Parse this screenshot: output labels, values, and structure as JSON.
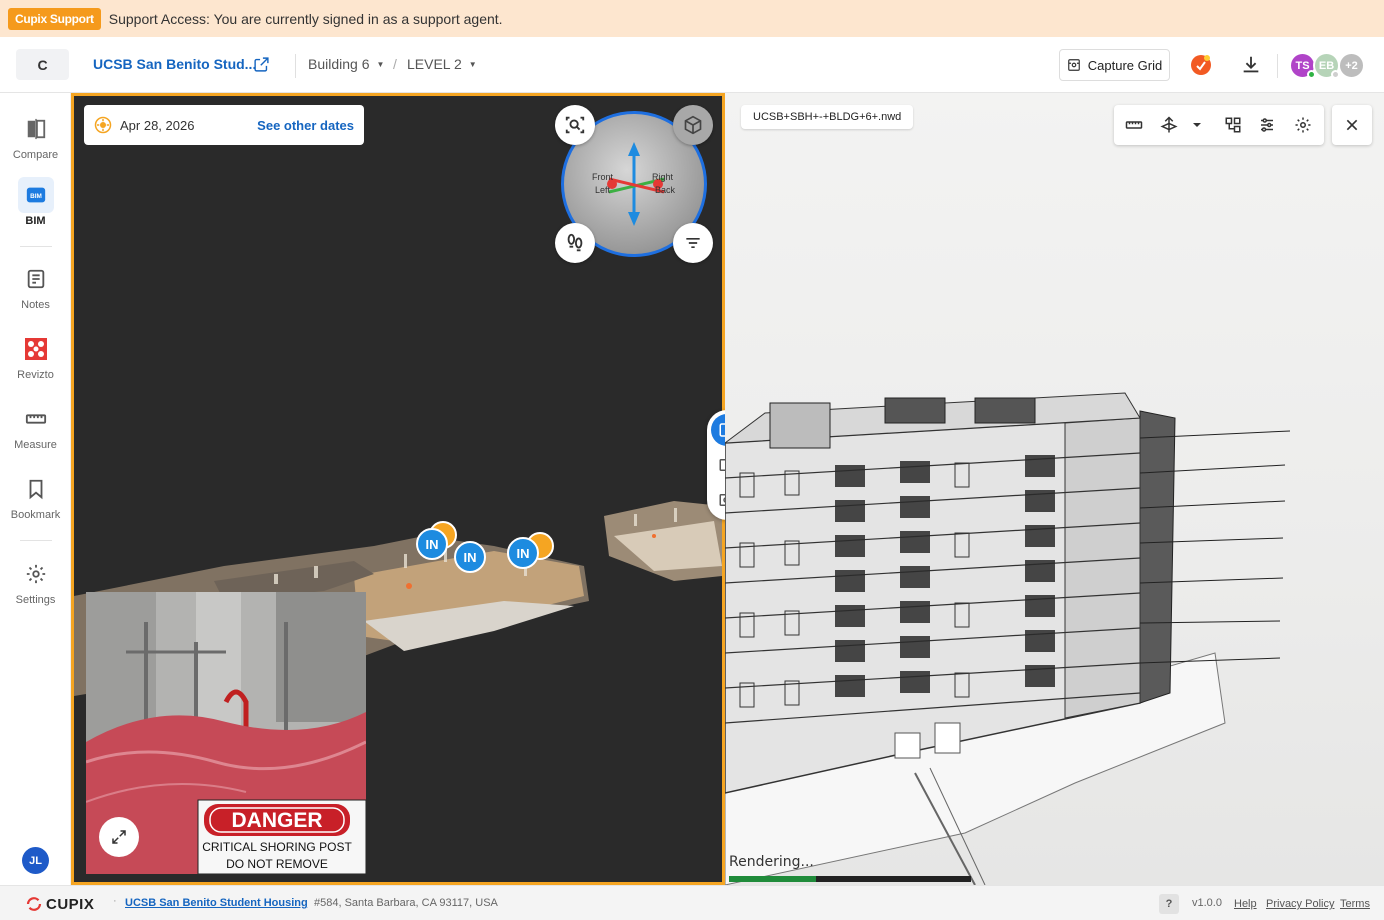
{
  "banner": {
    "badge": "Cupix Support",
    "text": "Support Access: You are currently signed in as a support agent."
  },
  "header": {
    "logo_letter": "C",
    "project_name": "UCSB San Benito Stud...",
    "breadcrumb": [
      {
        "label": "Building 6"
      },
      {
        "label": "LEVEL 2"
      }
    ],
    "breadcrumb_sep": "/",
    "capture_grid_label": "Capture Grid",
    "avatars": [
      {
        "initials": "TS",
        "color": "#b044c8",
        "status": "#2fb344"
      },
      {
        "initials": "EB",
        "color": "#b6d4b8",
        "status": "#cfcfcf"
      },
      {
        "initials": "+2",
        "color": "#bdbdbd"
      }
    ]
  },
  "sidebar": {
    "items": [
      {
        "label": "Compare",
        "icon": "compare-icon"
      },
      {
        "label": "BIM",
        "icon": "bim-icon"
      },
      {
        "label": "Notes",
        "icon": "notes-icon"
      },
      {
        "label": "Revizto",
        "icon": "revizto-icon"
      },
      {
        "label": "Measure",
        "icon": "ruler-icon"
      },
      {
        "label": "Bookmark",
        "icon": "bookmark-icon"
      },
      {
        "label": "Settings",
        "icon": "gear-icon"
      }
    ],
    "user_initials": "JL"
  },
  "left_viewer": {
    "date": "Apr 28, 2026",
    "see_other_dates": "See other dates",
    "gizmo_labels": {
      "front": "Front",
      "left": "Left",
      "right": "Right",
      "back": "Back"
    },
    "markers": [
      "IN",
      "IN",
      "IN"
    ],
    "photo_sign": {
      "title": "DANGER",
      "line1": "CRITICAL SHORING POST",
      "line2": "DO NOT REMOVE"
    }
  },
  "right_viewer": {
    "model_file": "UCSB+SBH+-+BLDG+6+.nwd",
    "rendering_text": "Rendering...",
    "render_progress": 0.36
  },
  "footer": {
    "brand": "CUPIX",
    "project_link": "UCSB San Benito Student Housing",
    "address": "#584, Santa Barbara, CA 93117, USA",
    "help_q": "?",
    "version": "v1.0.0",
    "help": "Help",
    "privacy": "Privacy Policy",
    "terms": "Terms"
  },
  "colors": {
    "accent": "#1565c0",
    "highlight_border": "#f5a522",
    "banner_bg": "#fde6cf",
    "marker_blue": "#1d8be0"
  }
}
